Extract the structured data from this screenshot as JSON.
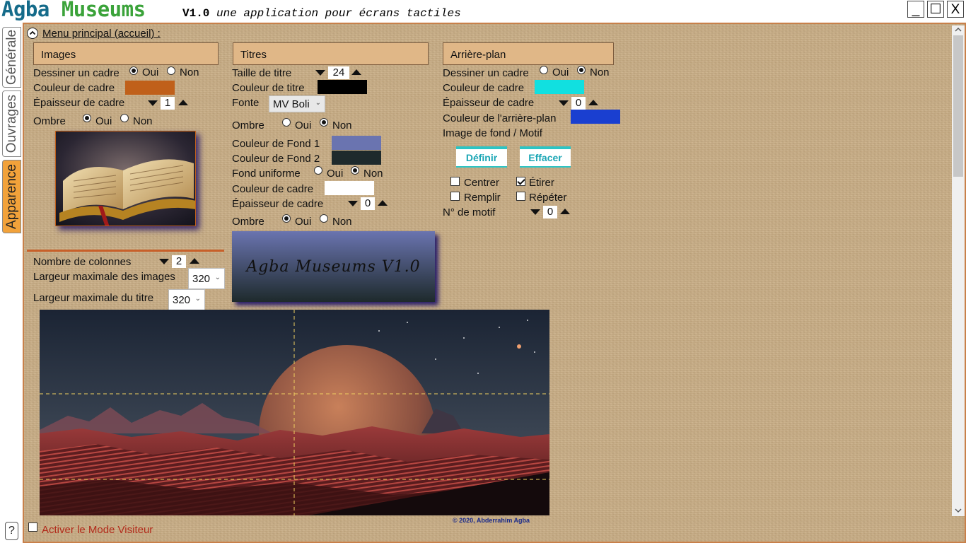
{
  "titlebar": {
    "app_name_part1": "Agba",
    "app_name_part2": "Museums",
    "version": "V1.0",
    "tagline": "une application pour écrans tactiles",
    "minimize": "_",
    "maximize": "☐",
    "close": "X"
  },
  "side_tabs": [
    {
      "label": "Générale",
      "active": false
    },
    {
      "label": "Ouvrages",
      "active": false
    },
    {
      "label": "Apparence",
      "active": true
    }
  ],
  "help_label": "?",
  "menu": {
    "label": "Menu principal (accueil) :"
  },
  "images": {
    "header": "Images",
    "draw_frame_label": "Dessiner un cadre",
    "draw_frame_yes": "Oui",
    "draw_frame_no": "Non",
    "draw_frame_value": "Oui",
    "frame_color_label": "Couleur de cadre",
    "frame_color": "#c0601a",
    "frame_thickness_label": "Épaisseur de cadre",
    "frame_thickness": "1",
    "shadow_label": "Ombre",
    "shadow_yes": "Oui",
    "shadow_no": "Non",
    "shadow_value": "Oui",
    "thumbnail": "open-book-photo"
  },
  "titles": {
    "header": "Titres",
    "size_label": "Taille de titre",
    "size_value": "24",
    "color_label": "Couleur de titre",
    "title_color": "#000000",
    "font_label": "Fonte",
    "font_value": "MV Boli",
    "shadow_label": "Ombre",
    "shadow_yes": "Oui",
    "shadow_no": "Non",
    "shadow_value": "Non",
    "bg1_label": "Couleur de Fond 1",
    "bg1_color": "#6a74b0",
    "bg2_label": "Couleur de Fond 2",
    "bg2_color": "#1e2a2c",
    "uniform_label": "Fond uniforme",
    "uniform_yes": "Oui",
    "uniform_no": "Non",
    "uniform_value": "Non",
    "frame_color_label": "Couleur de cadre",
    "frame_color": "#ffffff",
    "frame_thickness_label": "Épaisseur de cadre",
    "frame_thickness": "0",
    "shadow2_label": "Ombre",
    "shadow2_yes": "Oui",
    "shadow2_no": "Non",
    "shadow2_value": "Oui",
    "preview_text": "Agba Museums V1.0"
  },
  "background": {
    "header": "Arrière-plan",
    "draw_frame_label": "Dessiner un cadre",
    "draw_frame_yes": "Oui",
    "draw_frame_no": "Non",
    "draw_frame_value": "Non",
    "frame_color_label": "Couleur de cadre",
    "frame_color": "#11e0e0",
    "frame_thickness_label": "Épaisseur de cadre",
    "frame_thickness": "0",
    "bg_color_label": "Couleur de l'arrière-plan",
    "bg_color": "#1a3fd0",
    "image_label": "Image de fond / Motif",
    "define_button": "Définir",
    "clear_button": "Effacer",
    "center_label": "Centrer",
    "center_checked": false,
    "stretch_label": "Étirer",
    "stretch_checked": true,
    "fill_label": "Remplir",
    "fill_checked": false,
    "repeat_label": "Répéter",
    "repeat_checked": false,
    "motif_label": "N° de motif",
    "motif_value": "0"
  },
  "layout_settings": {
    "columns_label": "Nombre de colonnes",
    "columns_value": "2",
    "max_image_width_label": "Largeur maximale des images",
    "max_image_width": "320",
    "max_title_width_label": "Largeur maximale du titre",
    "max_title_width": "320"
  },
  "preview": {
    "image": "moon-over-red-mountains",
    "copyright": "© 2020, Abderrahim Agba"
  },
  "visitor_mode": {
    "label": "Activer le Mode Visiteur",
    "checked": false
  }
}
